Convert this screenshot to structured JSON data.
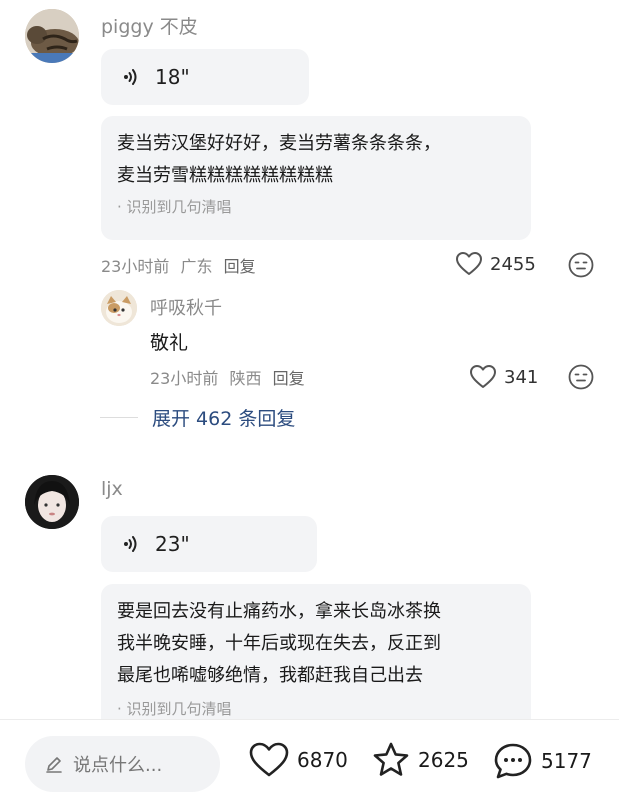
{
  "comments": [
    {
      "username": "piggy 不皮",
      "voice_duration": "18\"",
      "transcript_lines": [
        "麦当劳汉堡好好好，麦当劳薯条条条条，",
        "麦当劳雪糕糕糕糕糕糕糕糕"
      ],
      "transcript_note": "· 识别到几句清唱",
      "time": "23小时前",
      "location": "广东",
      "reply_label": "回复",
      "likes": "2455",
      "reply": {
        "username": "呼吸秋千",
        "text": "敬礼",
        "time": "23小时前",
        "location": "陕西",
        "reply_label": "回复",
        "likes": "341"
      },
      "expand_label": "展开 462 条回复"
    },
    {
      "username": "ljx",
      "voice_duration": "23\"",
      "transcript_lines": [
        "要是回去没有止痛药水，拿来长岛冰茶换",
        "我半晚安睡，十年后或现在失去，反正到",
        "最尾也唏嘘够绝情，我都赶我自己出去"
      ],
      "transcript_note": "· 识别到几句清唱"
    }
  ],
  "bottom_bar": {
    "input_placeholder": "说点什么...",
    "likes": "6870",
    "favorites": "2625",
    "comments": "5177"
  },
  "icons": {
    "voice": "sound-wave-icon",
    "like": "heart-icon",
    "emoji": "emoji-face-icon",
    "star": "star-icon",
    "comment": "comment-bubble-icon",
    "pencil": "pencil-icon"
  }
}
